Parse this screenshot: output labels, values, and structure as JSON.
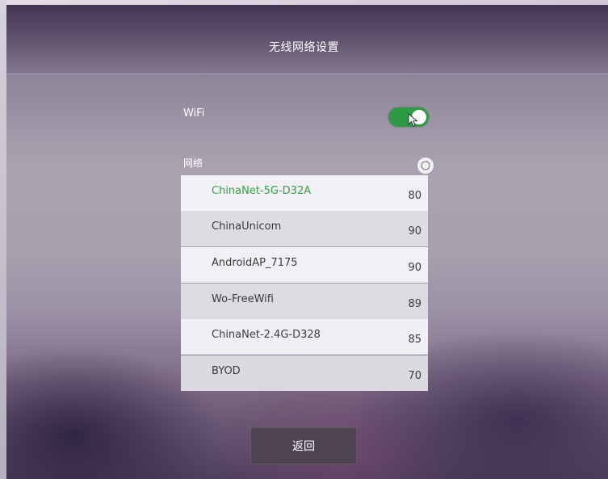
{
  "header": {
    "title": "无线网络设置"
  },
  "wifi": {
    "label": "WiFi",
    "enabled": true,
    "accent": "#2e9a45"
  },
  "networks": {
    "label": "网络",
    "refresh_icon": "refresh-icon",
    "items": [
      {
        "name": "ChinaNet-5G-D32A",
        "signal": "80",
        "connected": true
      },
      {
        "name": "ChinaUnicom",
        "signal": "90",
        "connected": false
      },
      {
        "name": "AndroidAP_7175",
        "signal": "90",
        "connected": false
      },
      {
        "name": "Wo-FreeWifi",
        "signal": "89",
        "connected": false
      },
      {
        "name": "ChinaNet-2.4G-D328",
        "signal": "85",
        "connected": false
      },
      {
        "name": "BYOD",
        "signal": "70",
        "connected": false
      }
    ],
    "active_color": "#35a24a"
  },
  "footer": {
    "back_label": "返回"
  }
}
